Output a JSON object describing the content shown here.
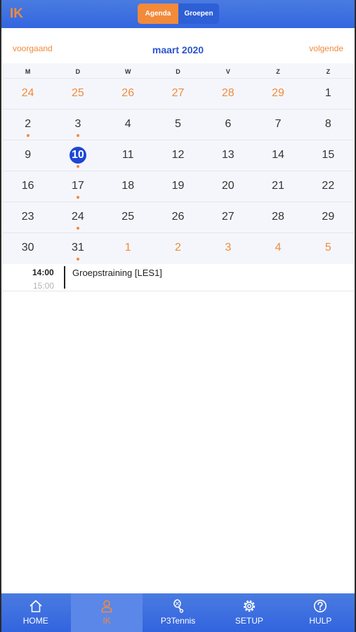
{
  "header": {
    "brand": "IK",
    "segments": [
      "Agenda",
      "Groepen"
    ],
    "active_segment": "Agenda"
  },
  "calendar": {
    "prev_label": "voorgaand",
    "next_label": "volgende",
    "month_title": "maart 2020",
    "weekdays": [
      "M",
      "D",
      "W",
      "D",
      "V",
      "Z",
      "Z"
    ],
    "weeks": [
      [
        {
          "d": "24",
          "o": true
        },
        {
          "d": "25",
          "o": true
        },
        {
          "d": "26",
          "o": true
        },
        {
          "d": "27",
          "o": true
        },
        {
          "d": "28",
          "o": true
        },
        {
          "d": "29",
          "o": true
        },
        {
          "d": "1"
        }
      ],
      [
        {
          "d": "2",
          "dot": true
        },
        {
          "d": "3",
          "dot": true
        },
        {
          "d": "4"
        },
        {
          "d": "5"
        },
        {
          "d": "6"
        },
        {
          "d": "7"
        },
        {
          "d": "8"
        }
      ],
      [
        {
          "d": "9"
        },
        {
          "d": "10",
          "today": true,
          "dot": true
        },
        {
          "d": "11"
        },
        {
          "d": "12"
        },
        {
          "d": "13"
        },
        {
          "d": "14"
        },
        {
          "d": "15"
        }
      ],
      [
        {
          "d": "16"
        },
        {
          "d": "17",
          "dot": true
        },
        {
          "d": "18"
        },
        {
          "d": "19"
        },
        {
          "d": "20"
        },
        {
          "d": "21"
        },
        {
          "d": "22"
        }
      ],
      [
        {
          "d": "23"
        },
        {
          "d": "24",
          "dot": true
        },
        {
          "d": "25"
        },
        {
          "d": "26"
        },
        {
          "d": "27"
        },
        {
          "d": "28"
        },
        {
          "d": "29"
        }
      ],
      [
        {
          "d": "30"
        },
        {
          "d": "31",
          "dot": true
        },
        {
          "d": "1",
          "o": true
        },
        {
          "d": "2",
          "o": true
        },
        {
          "d": "3",
          "o": true
        },
        {
          "d": "4",
          "o": true
        },
        {
          "d": "5",
          "o": true
        }
      ]
    ]
  },
  "event": {
    "start": "14:00",
    "end": "15:00",
    "title": "Groepstraining [LES1]"
  },
  "tabbar": {
    "active": "IK",
    "tabs": [
      {
        "label": "HOME",
        "icon": "home-icon"
      },
      {
        "label": "IK",
        "icon": "user-icon"
      },
      {
        "label": "P3Tennis",
        "icon": "tennis-racket-icon"
      },
      {
        "label": "SETUP",
        "icon": "gear-icon"
      },
      {
        "label": "HULP",
        "icon": "help-icon"
      }
    ]
  },
  "colors": {
    "primary_blue": "#3366e0",
    "accent_orange": "#f08a3c",
    "today_blue": "#1c47d6"
  }
}
